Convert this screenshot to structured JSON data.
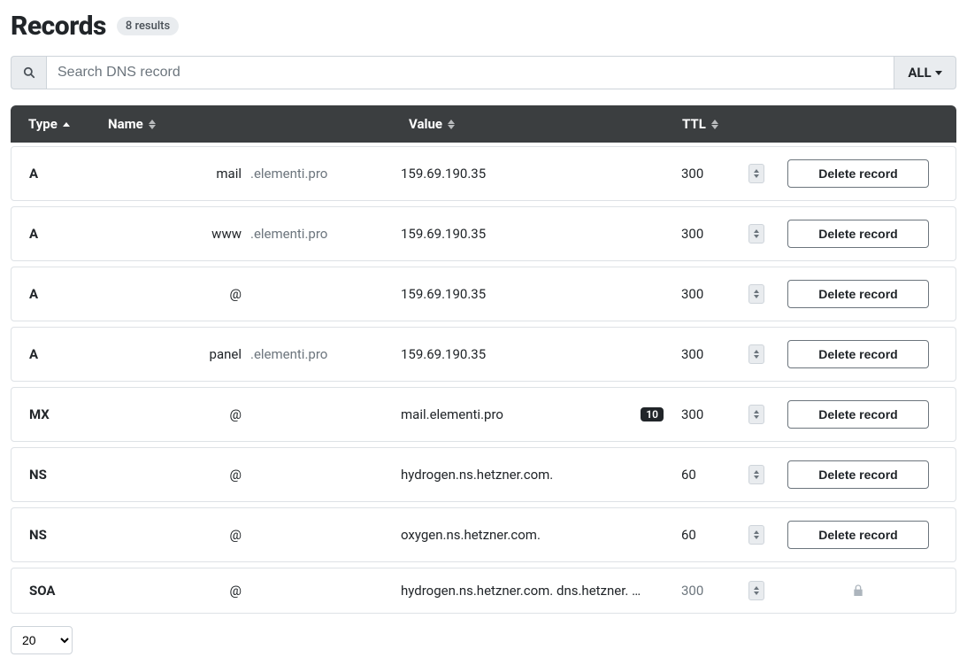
{
  "header": {
    "title": "Records",
    "results_badge": "8 results"
  },
  "search": {
    "placeholder": "Search DNS record",
    "filter_label": "ALL"
  },
  "columns": {
    "type": "Type",
    "name": "Name",
    "value": "Value",
    "ttl": "TTL"
  },
  "labels": {
    "delete": "Delete record"
  },
  "domain_suffix": ".elementi.pro",
  "records": [
    {
      "type": "A",
      "name": "mail",
      "show_suffix": true,
      "value": "159.69.190.35",
      "ttl": "300",
      "priority": null,
      "locked": false
    },
    {
      "type": "A",
      "name": "www",
      "show_suffix": true,
      "value": "159.69.190.35",
      "ttl": "300",
      "priority": null,
      "locked": false
    },
    {
      "type": "A",
      "name": "@",
      "show_suffix": false,
      "value": "159.69.190.35",
      "ttl": "300",
      "priority": null,
      "locked": false
    },
    {
      "type": "A",
      "name": "panel",
      "show_suffix": true,
      "value": "159.69.190.35",
      "ttl": "300",
      "priority": null,
      "locked": false
    },
    {
      "type": "MX",
      "name": "@",
      "show_suffix": false,
      "value": "mail.elementi.pro",
      "ttl": "300",
      "priority": "10",
      "locked": false
    },
    {
      "type": "NS",
      "name": "@",
      "show_suffix": false,
      "value": "hydrogen.ns.hetzner.com.",
      "ttl": "60",
      "priority": null,
      "locked": false
    },
    {
      "type": "NS",
      "name": "@",
      "show_suffix": false,
      "value": "oxygen.ns.hetzner.com.",
      "ttl": "60",
      "priority": null,
      "locked": false
    },
    {
      "type": "SOA",
      "name": "@",
      "show_suffix": false,
      "value": "hydrogen.ns.hetzner.com. dns.hetzner. …",
      "ttl": "300",
      "priority": null,
      "locked": true
    }
  ],
  "pagination": {
    "page_size": "20"
  }
}
